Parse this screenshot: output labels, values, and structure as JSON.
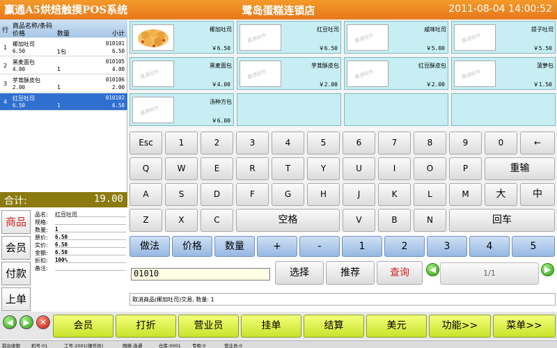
{
  "title_bar": {
    "app_title": "赢通A5烘焙触摸POS系统",
    "store_name": "鹭岛蛋糕连锁店",
    "datetime": "2011-08-04  14:00:52"
  },
  "order_list": {
    "header": {
      "row_no": "行",
      "name_code": "商品名称/条码",
      "price": "价格",
      "qty": "数量",
      "subtotal": "小计"
    },
    "rows": [
      {
        "no": "1",
        "name": "椰加吐司",
        "code": "010101",
        "price": "6.50",
        "qty": "1包",
        "subtotal": "6.50",
        "selected": false
      },
      {
        "no": "2",
        "name": "黑麦面包",
        "code": "010105",
        "price": "4.00",
        "qty": "1",
        "subtotal": "4.00",
        "selected": false
      },
      {
        "no": "3",
        "name": "芋茸酥皮包",
        "code": "010106",
        "price": "2.00",
        "qty": "1",
        "subtotal": "2.00",
        "selected": false
      },
      {
        "no": "4",
        "name": "红豆吐司",
        "code": "010102",
        "price": "6.50",
        "qty": "1",
        "subtotal": "6.50",
        "selected": true
      }
    ]
  },
  "total": {
    "label": "合计:",
    "value": "19.00"
  },
  "side_tabs": [
    {
      "label": "商品",
      "active": true
    },
    {
      "label": "会员",
      "active": false
    },
    {
      "label": "付款",
      "active": false
    },
    {
      "label": "上单",
      "active": false
    }
  ],
  "detail": {
    "fields": [
      {
        "label": "品名:",
        "value": "红豆吐司"
      },
      {
        "label": "规格:",
        "value": ""
      },
      {
        "label": "数量:",
        "value": "1"
      },
      {
        "label": "原价:",
        "value": "6.50"
      },
      {
        "label": "实价:",
        "value": "6.50"
      },
      {
        "label": "金额:",
        "value": "6.50"
      },
      {
        "label": "折扣:",
        "value": "100%"
      },
      {
        "label": "备注:",
        "value": ""
      }
    ]
  },
  "products": [
    {
      "name": "椰加吐司",
      "price": "￥6.50",
      "image": "bread-photo"
    },
    {
      "name": "红豆吐司",
      "price": "￥6.50",
      "image": "placeholder"
    },
    {
      "name": "咸味吐司",
      "price": "￥5.00",
      "image": "placeholder"
    },
    {
      "name": "提子吐司",
      "price": "￥5.50",
      "image": "placeholder"
    },
    {
      "name": "黑麦面包",
      "price": "￥4.00",
      "image": "placeholder"
    },
    {
      "name": "芋茸酥皮包",
      "price": "￥2.00",
      "image": "placeholder"
    },
    {
      "name": "红豆酥皮包",
      "price": "￥2.00",
      "image": "placeholder"
    },
    {
      "name": "菠萝包",
      "price": "￥1.50",
      "image": "placeholder"
    },
    {
      "name": "汤种方包",
      "price": "￥6.00",
      "image": "placeholder"
    }
  ],
  "watermark": "赢通软件",
  "keyboard": {
    "row1": [
      "Esc",
      "1",
      "2",
      "3",
      "4",
      "5",
      "6",
      "7",
      "8",
      "9",
      "0",
      "←"
    ],
    "row2": [
      "Q",
      "W",
      "E",
      "R",
      "T",
      "Y",
      "U",
      "I",
      "O",
      "P",
      "重输"
    ],
    "row3": [
      "A",
      "S",
      "D",
      "F",
      "G",
      "H",
      "J",
      "K",
      "L",
      "M",
      "大",
      "中"
    ],
    "row4": [
      "Z",
      "X",
      "C",
      "空格",
      "V",
      "B",
      "N",
      "回车"
    ]
  },
  "function_keys": [
    "做法",
    "价格",
    "数量",
    "+",
    "-",
    "1",
    "2",
    "3",
    "4",
    "5"
  ],
  "input": {
    "value": "01010"
  },
  "search_buttons": {
    "select": "选择",
    "recommend": "推荐",
    "query": "查询"
  },
  "pager": {
    "text": "1/1"
  },
  "log": {
    "text": "取消商品(椰加吐司)交易, 数量: 1"
  },
  "bottom_buttons": [
    "会员",
    "打折",
    "营业员",
    "挂单",
    "结算",
    "美元",
    "功能>>",
    "菜单>>"
  ],
  "status_bar": {
    "items": [
      "前台收银",
      "机号:01",
      "工号:2001(操作员)",
      "网络:连通",
      "仓库:0001",
      "专柜:0",
      "营业员:0"
    ]
  },
  "colors": {
    "accent_orange": "#e8781a",
    "selected_row": "#2f6fd0",
    "product_bg": "#c6eef3",
    "total_bar": "#8a7a10",
    "bottom_key": "#c8e32b"
  }
}
